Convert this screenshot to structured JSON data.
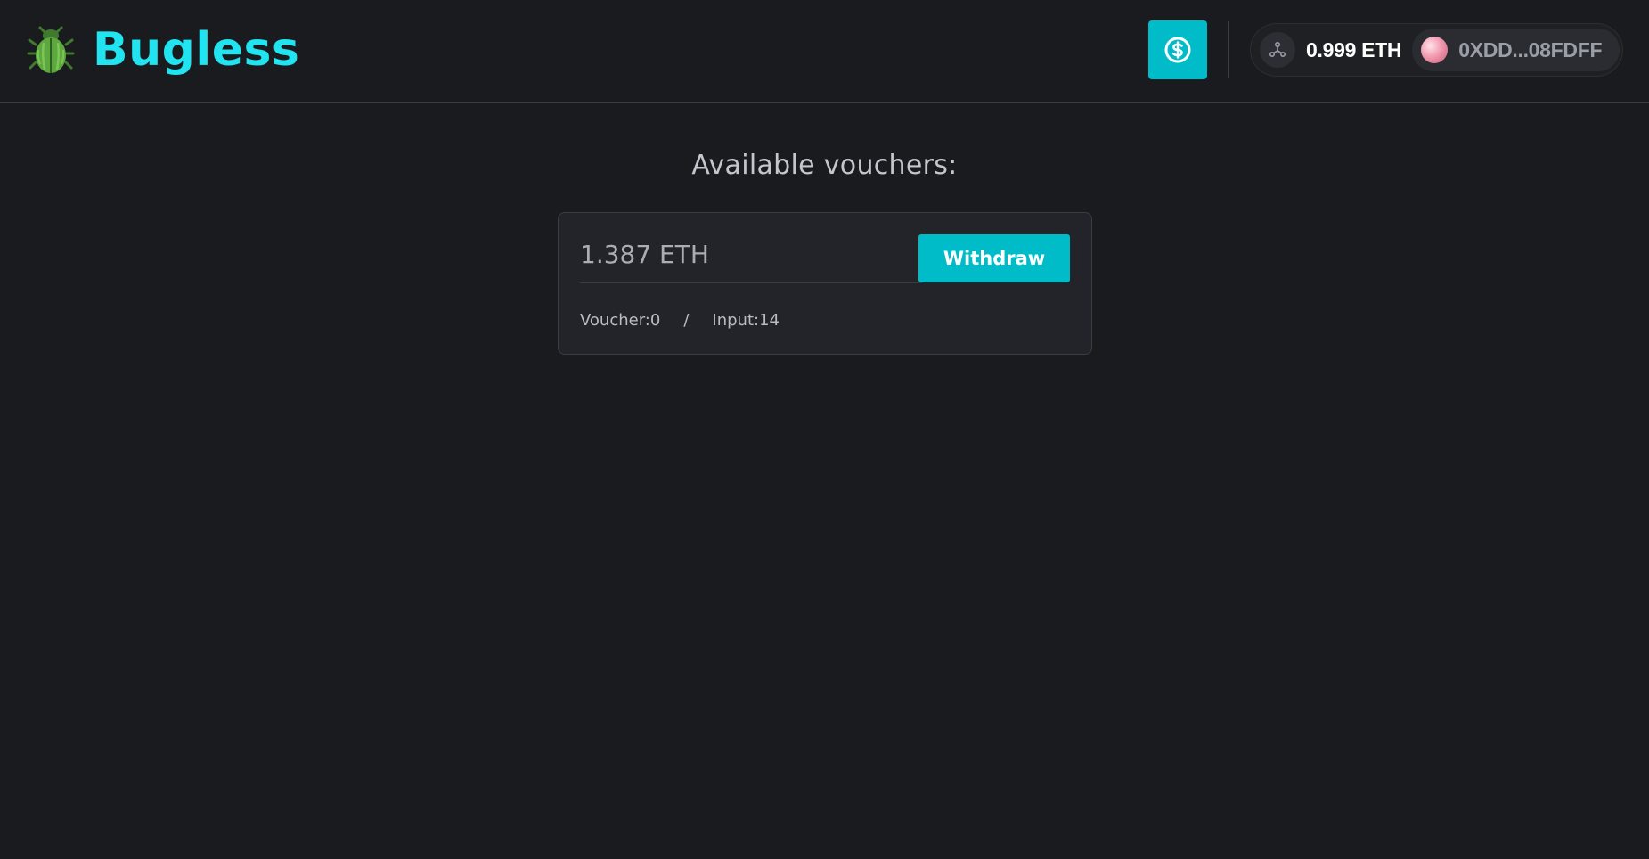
{
  "header": {
    "title": "Bugless",
    "balance": "0.999 ETH",
    "account": "0XDD...08FDFF"
  },
  "main": {
    "title": "Available vouchers:",
    "vouchers": [
      {
        "amount": "1.387 ETH",
        "withdraw_label": "Withdraw",
        "voucher_label": "Voucher:0",
        "separator": "/",
        "input_label": "Input:14"
      }
    ]
  },
  "colors": {
    "accent": "#00bcc8",
    "brand_text": "#22e3f0",
    "background": "#1a1b1f",
    "card": "#232429"
  },
  "icons": {
    "brand": "bug-icon",
    "fund": "dollar-circle-icon",
    "network": "network-icon"
  }
}
